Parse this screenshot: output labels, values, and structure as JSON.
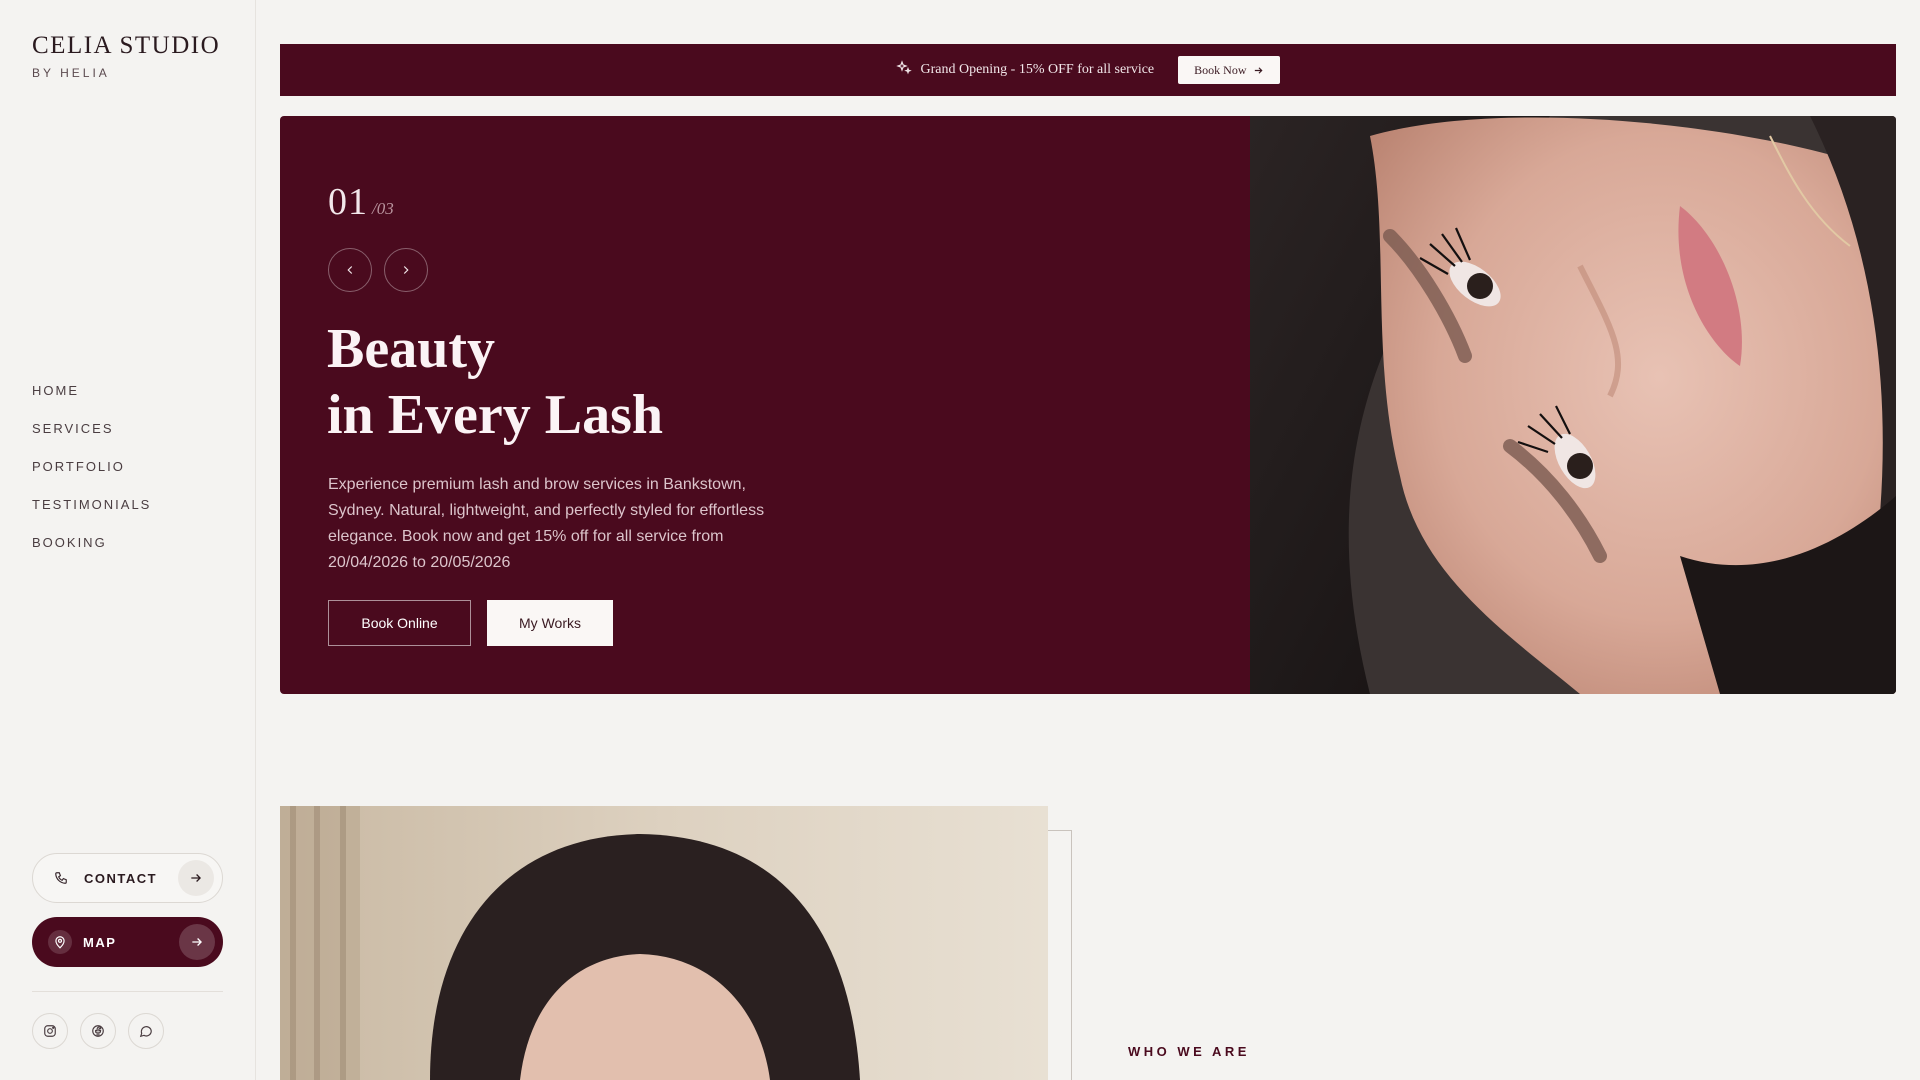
{
  "brand": {
    "title": "CELIA STUDIO",
    "subtitle": "BY HELIA"
  },
  "nav": {
    "items": [
      "HOME",
      "SERVICES",
      "PORTFOLIO",
      "TESTIMONIALS",
      "BOOKING"
    ]
  },
  "sidebar": {
    "contact_label": "CONTACT",
    "map_label": "MAP",
    "social": [
      "instagram-icon",
      "facebook-icon",
      "chat-icon"
    ]
  },
  "banner": {
    "text": "Grand Opening - 15% OFF for all service",
    "button_label": "Book Now"
  },
  "hero": {
    "counter_current": "01",
    "counter_total": "/03",
    "title_line1": "Beauty",
    "title_line2": "in Every Lash",
    "description": "Experience premium lash and brow services in Bankstown, Sydney. Natural, lightweight, and perfectly styled for effortless elegance. Book now and get 15% off for all service from 20/04/2026 to 20/05/2026",
    "primary_button": "Book Online",
    "secondary_button": "My Works"
  },
  "about": {
    "eyebrow": "WHO WE ARE"
  },
  "colors": {
    "brand": "#4a0a1e",
    "background": "#f4f3f1",
    "light": "#faf7f5"
  }
}
